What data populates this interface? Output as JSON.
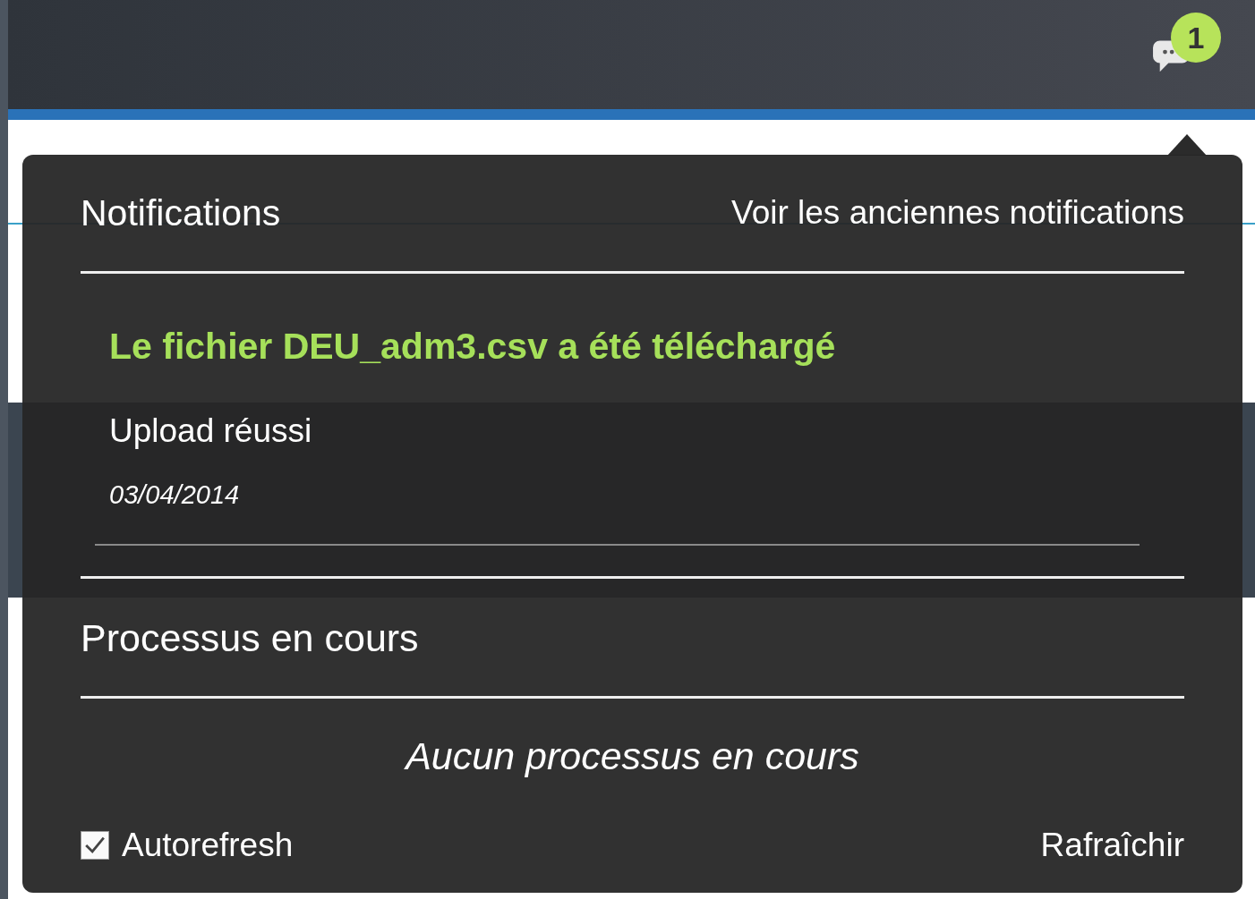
{
  "header": {
    "notification_count": "1"
  },
  "popup": {
    "title": "Notifications",
    "history_link": "Voir les anciennes notifications",
    "notifications": [
      {
        "title": "Le fichier DEU_adm3.csv a été téléchargé",
        "message": "Upload réussi",
        "date": "03/04/2014"
      }
    ],
    "processes_title": "Processus en cours",
    "empty_message": "Aucun processus en cours",
    "autorefresh": {
      "label": "Autorefresh",
      "checked": true
    },
    "refresh_button": "Rafraîchir"
  }
}
